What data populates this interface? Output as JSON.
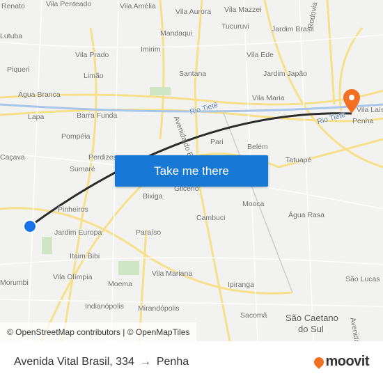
{
  "map": {
    "labels": [
      "Renato",
      "Vila Penteado",
      "Vila Amélia",
      "Vila Aurora",
      "Vila Mazzei",
      "Tucuruvi",
      "Jardim Brasil",
      "Mandaqui",
      "Imirim",
      "Vila Prado",
      "Limão",
      "Piqueri",
      "Santana",
      "Vila Ede",
      "Jardim Japão",
      "Água Branca",
      "Vila Maria",
      "Barra Funda",
      "Lapa",
      "Pompéia",
      "Pari",
      "Belém",
      "Perdizes",
      "Sumaré",
      "Tatuapé",
      "Bixiga",
      "Glicério",
      "Mooca",
      "Pinheiros",
      "Jardim Europa",
      "Paraíso",
      "Cambuci",
      "Água Rasa",
      "Itaim Bibi",
      "Vila Mariana",
      "Vila Olímpia",
      "Moema",
      "Ipiranga",
      "São Lucas",
      "Indianópolis",
      "Mirandópolis",
      "Sacomã",
      "São Caetano",
      "do Sul",
      "Morumbi",
      "Penha",
      "Vila Laís",
      "Caçava",
      "Lutuba"
    ],
    "rivers": [
      "Rio Tietê",
      "Rio Tietê"
    ],
    "roads": [
      "Rodovia Fernão Dias",
      "Avenida do Estado",
      "Avenida"
    ],
    "route_color": "#2b2b2b",
    "origin_color": "#1a73e8",
    "destination_color": "#f36f21"
  },
  "cta": {
    "label": "Take me there"
  },
  "attribution": "© OpenStreetMap contributors | © OpenMapTiles",
  "footer": {
    "origin": "Avenida Vital Brasil, 334",
    "arrow": "→",
    "destination": "Penha"
  },
  "logo": {
    "text": "moovit",
    "color": "#f36f21"
  }
}
